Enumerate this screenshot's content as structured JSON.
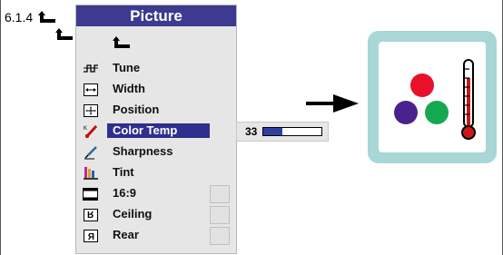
{
  "section": {
    "number": "6.1.4"
  },
  "menu": {
    "title": "Picture",
    "items": [
      {
        "label": "Tune",
        "icon": "tune-icon"
      },
      {
        "label": "Width",
        "icon": "width-icon"
      },
      {
        "label": "Position",
        "icon": "position-icon"
      },
      {
        "label": "Color Temp",
        "icon": "thermometer-icon",
        "selected": true
      },
      {
        "label": "Sharpness",
        "icon": "sharpness-icon"
      },
      {
        "label": "Tint",
        "icon": "tint-icon"
      },
      {
        "label": "16:9",
        "icon": "aspect-icon",
        "checkbox": true
      },
      {
        "label": "Ceiling",
        "icon": "ceiling-icon",
        "checkbox": true
      },
      {
        "label": "Rear",
        "icon": "rear-icon",
        "checkbox": true
      }
    ]
  },
  "slider": {
    "value": "33",
    "fraction": 0.33
  },
  "colors": {
    "menu_title_bg": "#3d3a8f",
    "selected_bg": "#2f2f8e",
    "red_circle": "#e8102a",
    "purple_circle": "#4a2290",
    "green_circle": "#14a850",
    "icon_box_border": "#a9d6d6"
  }
}
